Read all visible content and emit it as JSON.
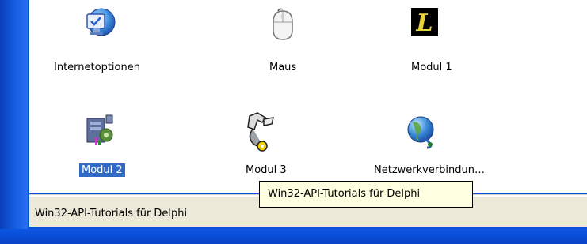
{
  "icons": [
    {
      "name": "internetoptionen",
      "label": "Internetoptionen",
      "selected": false,
      "icon": "internet-options-icon"
    },
    {
      "name": "maus",
      "label": "Maus",
      "selected": false,
      "icon": "mouse-icon"
    },
    {
      "name": "modul-1",
      "label": "Modul 1",
      "selected": false,
      "icon": "script-l-icon"
    },
    {
      "name": "modul-2",
      "label": "Modul 2",
      "selected": true,
      "icon": "server-gear-icon"
    },
    {
      "name": "modul-3",
      "label": "Modul 3",
      "selected": false,
      "icon": "tools-wrench-icon"
    },
    {
      "name": "netzwerkverbindungen",
      "label": "Netzwerkverbindun…",
      "selected": false,
      "icon": "network-globe-icon"
    }
  ],
  "tooltip": {
    "text": "Win32-API-Tutorials für Delphi"
  },
  "statusbar": {
    "text": "Win32-API-Tutorials für Delphi"
  },
  "colors": {
    "selection": "#316ac5",
    "tooltip_bg": "#ffffe1",
    "statusbar_bg": "#ece9d8",
    "frame": "#0b4fd8"
  }
}
